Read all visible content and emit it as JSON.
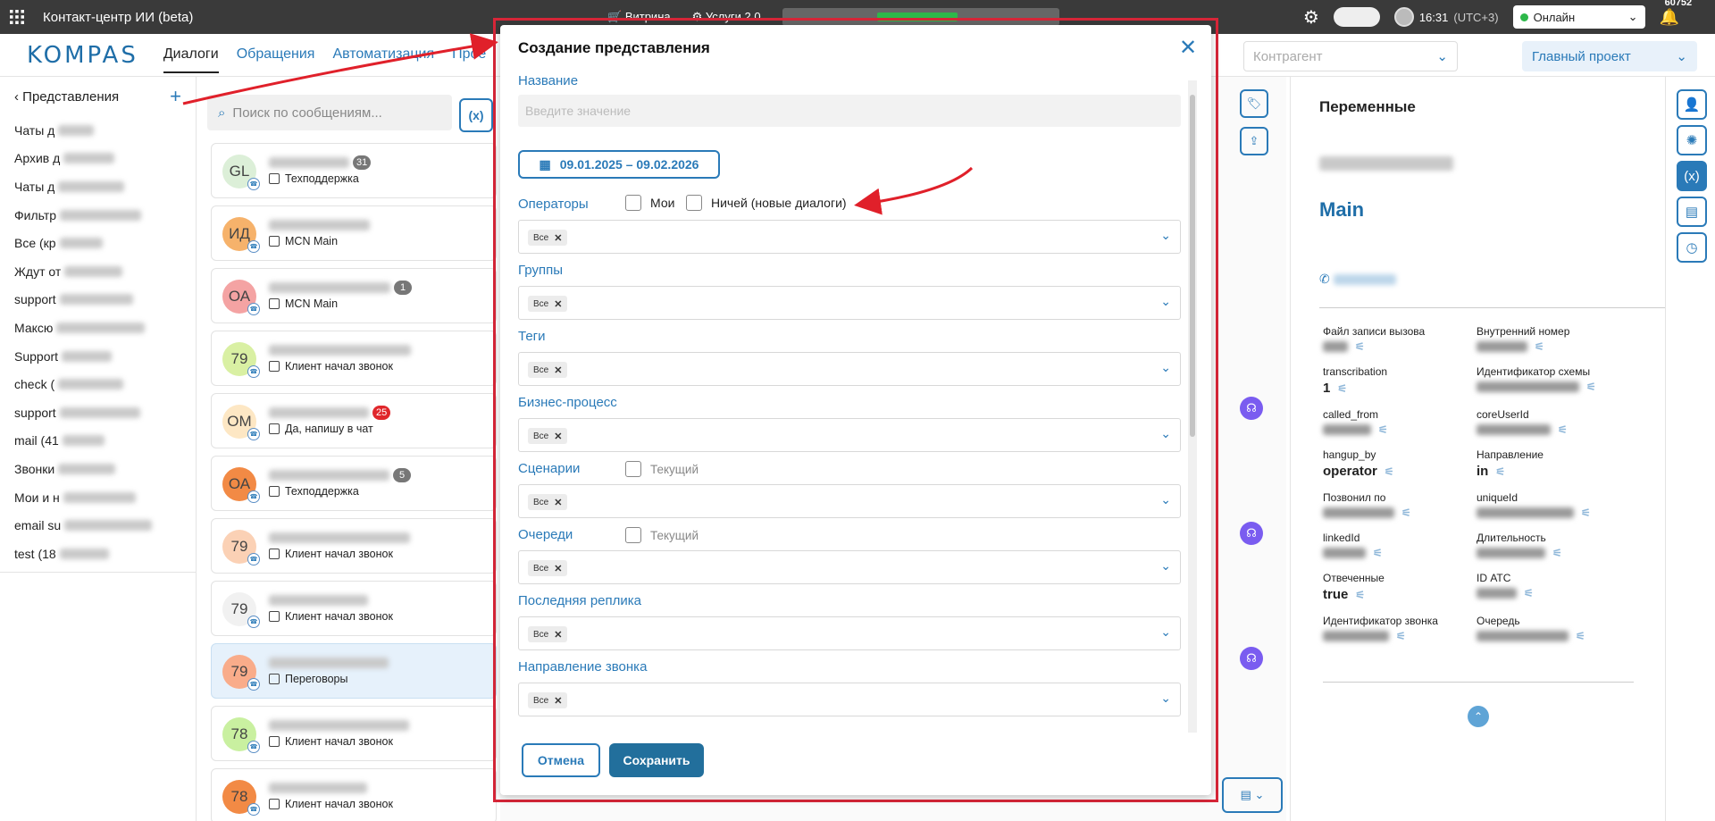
{
  "topbar": {
    "app_title": "Контакт-центр ИИ (beta)",
    "showcase": "Витрина",
    "services": "Услуги 2.0",
    "time": "16:31",
    "tz": "(UTC+3)",
    "status": "Онлайн",
    "bell_count": "60752"
  },
  "nav": {
    "logo": "KOMPAS",
    "tabs": [
      "Диалоги",
      "Обращения",
      "Автоматизация",
      "Прое"
    ],
    "counterparty_placeholder": "Контрагент",
    "project": "Главный проект"
  },
  "views": {
    "title": "Представления",
    "items": [
      "Чаты д",
      "Архив д",
      "Чаты д",
      "Фильтр",
      "Все (кр",
      "Ждут от",
      "support",
      "Максю",
      "Support",
      "check (",
      "support",
      "mail (41",
      "Звонки",
      "Мои и н",
      "email su",
      "test (18"
    ]
  },
  "search_placeholder": "Поиск по сообщениям...",
  "dialogs": [
    {
      "initials": "GL",
      "count": "31",
      "count_red": false,
      "sub": "Техподдержка",
      "bg": "#dcefd8"
    },
    {
      "initials": "ИД",
      "count": "",
      "count_red": false,
      "sub": "MCN Main",
      "bg": "#f6b26b"
    },
    {
      "initials": "ОА",
      "count": "1",
      "count_red": false,
      "sub": "MCN Main",
      "bg": "#f4a3a3"
    },
    {
      "initials": "79",
      "count": "",
      "count_red": false,
      "sub": "Клиент начал звонок",
      "bg": "#d9f0a3"
    },
    {
      "initials": "OM",
      "count": "25",
      "count_red": true,
      "sub": "Да, напишу в чат",
      "bg": "#fde7c4"
    },
    {
      "initials": "ОА",
      "count": "5",
      "count_red": false,
      "sub": "Техподдержка",
      "bg": "#f28a45"
    },
    {
      "initials": "79",
      "count": "",
      "count_red": false,
      "sub": "Клиент начал звонок",
      "bg": "#fbd1b5"
    },
    {
      "initials": "79",
      "count": "",
      "count_red": false,
      "sub": "Клиент начал звонок",
      "bg": "#f1f1f1"
    },
    {
      "initials": "79",
      "count": "",
      "count_red": false,
      "sub": "Переговоры",
      "bg": "#f9ac8a"
    },
    {
      "initials": "78",
      "count": "",
      "count_red": false,
      "sub": "Клиент начал звонок",
      "bg": "#c9f0a0"
    },
    {
      "initials": "78",
      "count": "",
      "count_red": false,
      "sub": "Клиент начал звонок",
      "bg": "#f28a45"
    }
  ],
  "variables": {
    "title": "Переменные",
    "main": "Main",
    "items": [
      {
        "k": "Файл записи вызова",
        "v": ""
      },
      {
        "k": "Внутренний номер",
        "v": ""
      },
      {
        "k": "transcribation",
        "v": "1"
      },
      {
        "k": "Идентификатор схемы",
        "v": ""
      },
      {
        "k": "called_from",
        "v": ""
      },
      {
        "k": "coreUserId",
        "v": ""
      },
      {
        "k": "hangup_by",
        "v": "operator"
      },
      {
        "k": "Направление",
        "v": "in"
      },
      {
        "k": "Позвонил по",
        "v": ""
      },
      {
        "k": "uniqueId",
        "v": ""
      },
      {
        "k": "linkedId",
        "v": ""
      },
      {
        "k": "Длительность",
        "v": ""
      },
      {
        "k": "Отвеченные",
        "v": "true"
      },
      {
        "k": "ID АТС",
        "v": ""
      },
      {
        "k": "Идентификатор звонка",
        "v": ""
      },
      {
        "k": "Очередь",
        "v": ""
      }
    ]
  },
  "modal": {
    "title": "Создание представления",
    "name_label": "Название",
    "name_placeholder": "Введите значение",
    "date_range": "09.01.2025 – 09.02.2026",
    "operators_label": "Операторы",
    "cb_mine": "Мои",
    "cb_nobody": "Ничей (новые диалоги)",
    "groups_label": "Группы",
    "tags_label": "Теги",
    "bp_label": "Бизнес-процесс",
    "scenarios_label": "Сценарии",
    "current_label": "Текущий",
    "queues_label": "Очереди",
    "last_reply_label": "Последняя реплика",
    "direction_label": "Направление звонка",
    "chip_all": "Все",
    "cancel": "Отмена",
    "save": "Сохранить"
  },
  "colors": {
    "accent": "#2a7ab8",
    "save_button": "#226f9c",
    "highlight_red": "#d72638",
    "topbar": "#3a3a3a"
  }
}
